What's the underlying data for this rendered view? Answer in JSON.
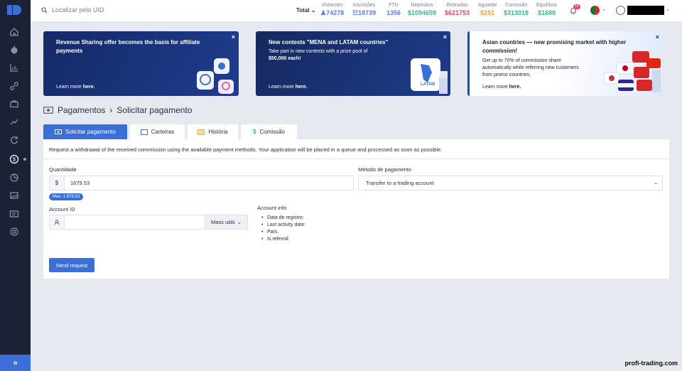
{
  "topbar": {
    "search_placeholder": "Localizar pelo UID",
    "total_label": "Total",
    "stats": [
      {
        "label": "Visitantes",
        "value": "74278",
        "color": "#5a7fd8"
      },
      {
        "label": "Inscrições",
        "value": "18739",
        "color": "#5a7fd8"
      },
      {
        "label": "FTD",
        "value": "1356",
        "color": "#5a7fd8"
      },
      {
        "label": "Depósitos",
        "value": "$1094659",
        "color": "#3cb38a"
      },
      {
        "label": "Retiradas",
        "value": "$621753",
        "color": "#e8435e"
      },
      {
        "label": "Aguarde",
        "value": "$251",
        "color": "#f0a030"
      },
      {
        "label": "Comissão",
        "value": "$313019",
        "color": "#3cb38a"
      },
      {
        "label": "Equilíbrio",
        "value": "$1680",
        "color": "#3cb38a"
      }
    ],
    "notifications": "14"
  },
  "banners": [
    {
      "title": "Revenue Sharing offer becomes the basis for affiliate payments",
      "text": "",
      "learn": "Learn more",
      "here": "here."
    },
    {
      "title": "New contests \"MENA and LATAM countries\"",
      "text": "Take part in new contests with a prize pool of",
      "text_bold": "$50,000 each!",
      "learn": "Learn more",
      "here": "here.",
      "badge": "LATAM"
    },
    {
      "title": "Asian countries — new promising market with higher commission!",
      "text": "Get up to 70% of commission share automatically while referring new customers from promo countries.",
      "learn": "Learn more",
      "here": "here."
    }
  ],
  "breadcrumb": {
    "section": "Pagamentos",
    "page": "Solicitar pagamento"
  },
  "tabs": [
    {
      "label": "Solicitar pagamento",
      "icon": "cash-icon"
    },
    {
      "label": "Carteiras",
      "icon": "wallet-icon"
    },
    {
      "label": "História",
      "icon": "history-icon"
    },
    {
      "label": "Comissão",
      "icon": "dollar-icon"
    }
  ],
  "form": {
    "description": "Request a withdrawal of the received commission using the available payment methods. Your application will be placed in a queue and processed as soon as possible.",
    "quantity_label": "Quantidade",
    "currency": "$",
    "quantity_value": "1679.53",
    "max_label": "Max: 1 679,53",
    "method_label": "Método de pagamento",
    "method_value": "Transfer to a trading account",
    "account_label": "Account ID",
    "account_value": "",
    "mass_label": "Mass uids",
    "info_title": "Account info",
    "info_items": [
      "Data de registro:",
      "Last activity date:",
      "País:",
      "Is referral:"
    ],
    "send_label": "Send request"
  },
  "watermark": "profi-trading.com"
}
